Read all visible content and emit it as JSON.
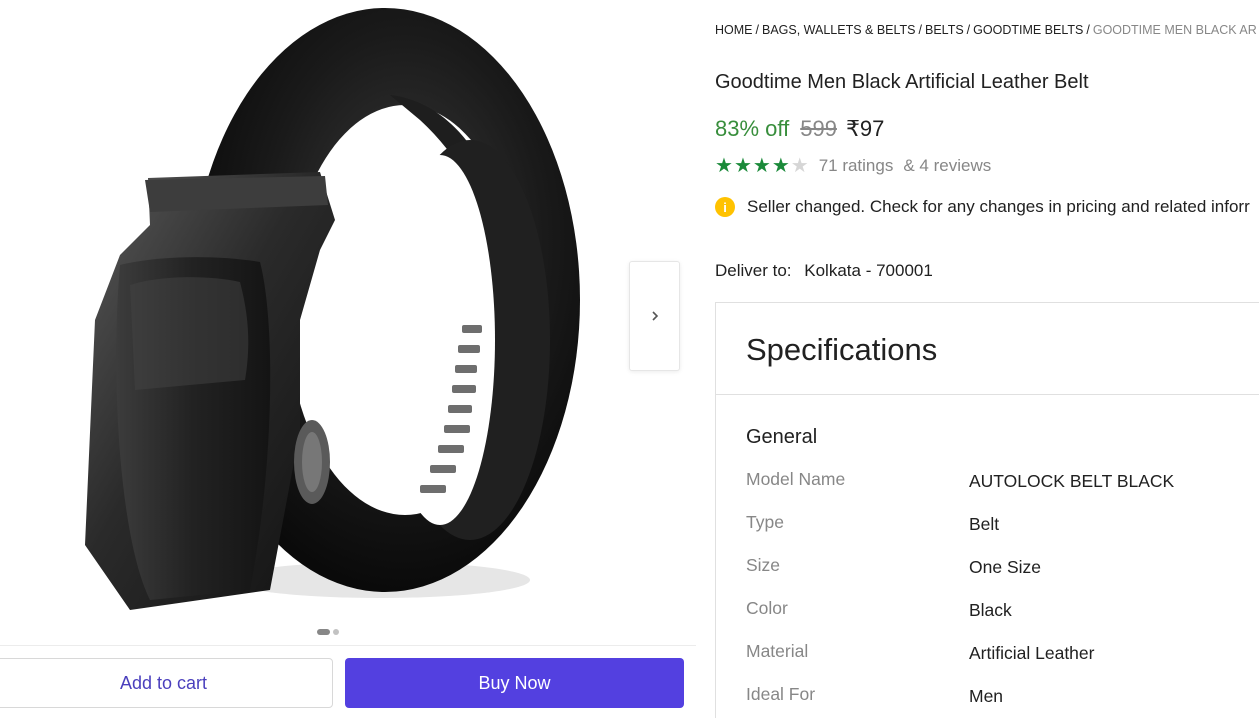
{
  "breadcrumb": {
    "items": [
      "HOME",
      "BAGS, WALLETS & BELTS",
      "BELTS",
      "GOODTIME BELTS"
    ],
    "current": "GOODTIME MEN BLACK AR",
    "separator": "/"
  },
  "product": {
    "title": "Goodtime Men Black Artificial Leather Belt",
    "discount": "83% off",
    "mrp": "599",
    "price": "₹97",
    "rating_stars": 4,
    "rating_max": 5,
    "ratings_text": "71 ratings",
    "reviews_text": "& 4 reviews"
  },
  "notice": {
    "icon": "info-icon",
    "text": "Seller changed. Check for any changes in pricing and related inforr"
  },
  "delivery": {
    "label": "Deliver to:",
    "location": "Kolkata - 700001"
  },
  "specifications": {
    "title": "Specifications",
    "group": "General",
    "rows": [
      {
        "key": "Model Name",
        "value": "AUTOLOCK BELT BLACK"
      },
      {
        "key": "Type",
        "value": "Belt"
      },
      {
        "key": "Size",
        "value": "One Size"
      },
      {
        "key": "Color",
        "value": "Black"
      },
      {
        "key": "Material",
        "value": "Artificial Leather"
      },
      {
        "key": "Ideal For",
        "value": "Men"
      }
    ]
  },
  "gallery": {
    "image_count": 2,
    "active_index": 0,
    "next_icon": "chevron-right-icon"
  },
  "actions": {
    "add_to_cart": "Add to cart",
    "buy_now": "Buy Now"
  },
  "colors": {
    "discount_green": "#388e3c",
    "star_green": "#1b8a3a",
    "buy_button": "#5340e0",
    "cart_text": "#4a3fbd",
    "notice_icon": "#ffc200"
  }
}
